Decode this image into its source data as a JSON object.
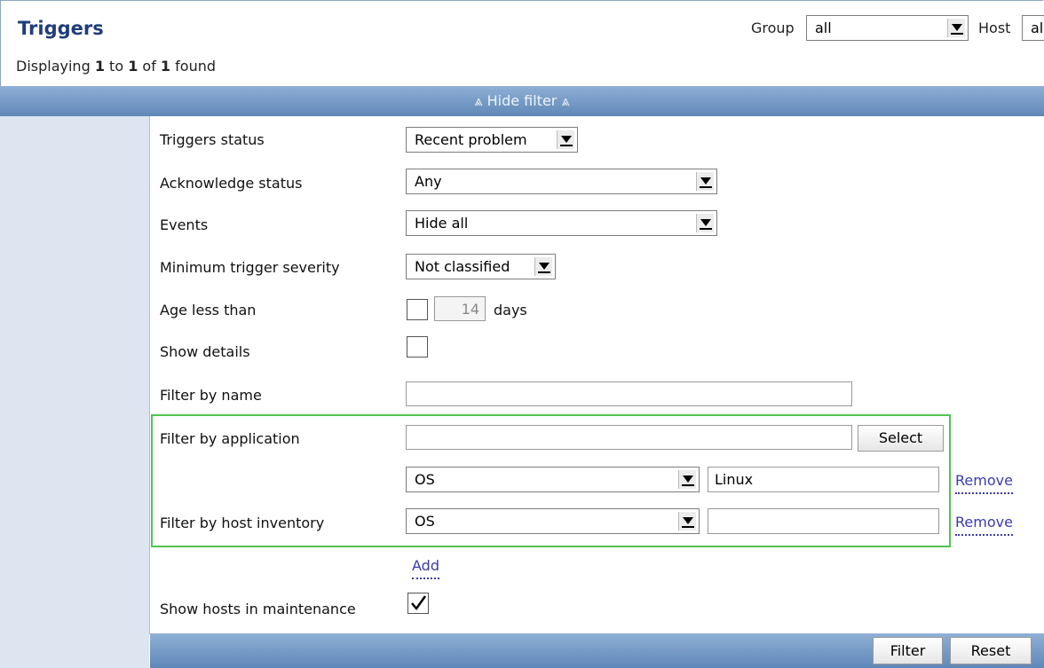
{
  "header": {
    "title": "Triggers",
    "displaying": {
      "prefix": "Displaying ",
      "from": "1",
      "to_word": " to ",
      "to": "1",
      "of_word": " of ",
      "total": "1",
      "suffix": " found"
    },
    "group_label": "Group",
    "group_value": "all",
    "host_label": "Host",
    "host_value": "all"
  },
  "filter_toggle": "⩓ Hide filter ⩓",
  "filter": {
    "triggers_status": {
      "label": "Triggers status",
      "value": "Recent problem"
    },
    "acknowledge_status": {
      "label": "Acknowledge status",
      "value": "Any"
    },
    "events": {
      "label": "Events",
      "value": "Hide all"
    },
    "min_severity": {
      "label": "Minimum trigger severity",
      "value": "Not classified"
    },
    "age_less_than": {
      "label": "Age less than",
      "checked": false,
      "days_value": "14",
      "days_label": "days"
    },
    "show_details": {
      "label": "Show details",
      "checked": false
    },
    "filter_by_name": {
      "label": "Filter by name",
      "value": ""
    },
    "filter_by_application": {
      "label": "Filter by application",
      "value": "",
      "select_button": "Select"
    },
    "inventory_rows": [
      {
        "field": "OS",
        "value": "Linux",
        "remove": "Remove"
      },
      {
        "field": "OS",
        "value": "",
        "remove": "Remove"
      }
    ],
    "filter_by_host_inventory": {
      "label": "Filter by host inventory"
    },
    "add_link": "Add",
    "show_hosts_in_maintenance": {
      "label": "Show hosts in maintenance",
      "checked": true
    }
  },
  "buttons": {
    "filter": "Filter",
    "reset": "Reset"
  }
}
